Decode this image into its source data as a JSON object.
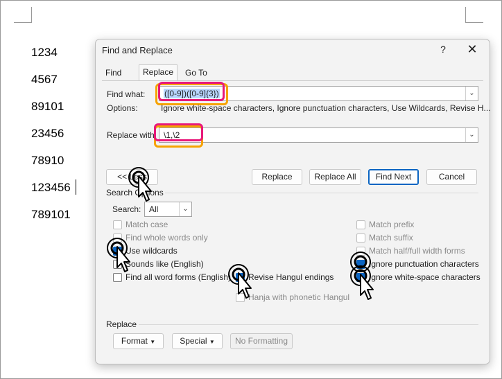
{
  "document": {
    "lines": [
      "1234",
      "4567",
      "89101",
      "23456",
      "78910",
      "123456",
      "789101"
    ]
  },
  "dialog": {
    "title": "Find and Replace",
    "help": "?",
    "close": "✕",
    "tabs": {
      "find": "Find",
      "replace": "Replace",
      "goto": "Go To"
    },
    "find_label": "Find what:",
    "find_value": "([0-9])([0-9]{3})",
    "options_label": "Options:",
    "options_value": "Ignore white-space characters, Ignore punctuation characters, Use Wildcards, Revise H...",
    "replace_label": "Replace with:",
    "replace_value": "\\1,\\2",
    "buttons": {
      "less": "<< Less",
      "replace": "Replace",
      "replace_all": "Replace All",
      "find_next": "Find Next",
      "cancel": "Cancel"
    },
    "search_options_label": "Search Options",
    "search_label": "Search:",
    "search_value": "All",
    "left_options": [
      {
        "label": "Match case",
        "checked": false,
        "enabled": false
      },
      {
        "label": "Find whole words only",
        "checked": false,
        "enabled": false
      },
      {
        "label": "Use wildcards",
        "checked": true,
        "enabled": true
      },
      {
        "label": "Sounds like (English)",
        "checked": false,
        "enabled": true
      },
      {
        "label": "Find all word forms (English)",
        "checked": false,
        "enabled": true
      }
    ],
    "mid_options": [
      {
        "label": "Revise Hangul endings",
        "checked": true,
        "enabled": true
      },
      {
        "label": "Hanja with phonetic Hangul",
        "checked": false,
        "enabled": false
      }
    ],
    "right_options": [
      {
        "label": "Match prefix",
        "checked": false,
        "enabled": false
      },
      {
        "label": "Match suffix",
        "checked": false,
        "enabled": false
      },
      {
        "label": "Match half/full width forms",
        "checked": false,
        "enabled": false
      },
      {
        "label": "Ignore punctuation characters",
        "checked": true,
        "enabled": true
      },
      {
        "label": "Ignore white-space characters",
        "checked": true,
        "enabled": true
      }
    ],
    "replace_section_label": "Replace",
    "format_button": "Format",
    "special_button": "Special",
    "no_formatting_button": "No Formatting",
    "accent_color": "#0a64c2",
    "highlight_colors": {
      "outer": "#f6a200",
      "inner": "#e8197a"
    }
  }
}
